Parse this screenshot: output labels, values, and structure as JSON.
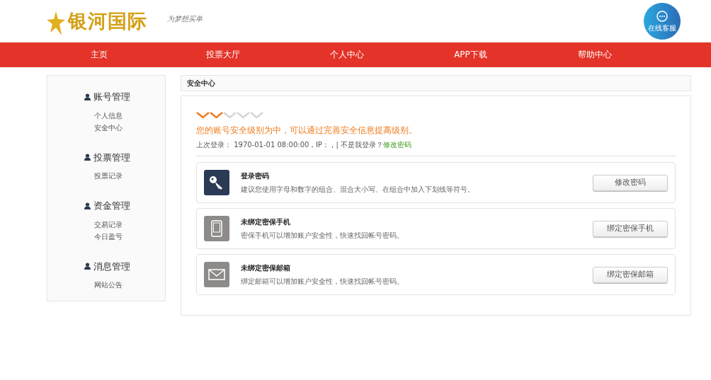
{
  "header": {
    "logo_text": "银河国际",
    "tagline": "为梦想买单",
    "service_label": "在线客服"
  },
  "nav": [
    {
      "label": "主页"
    },
    {
      "label": "投票大厅"
    },
    {
      "label": "个人中心"
    },
    {
      "label": "APP下载"
    },
    {
      "label": "帮助中心"
    }
  ],
  "sidebar": [
    {
      "title": "账号管理",
      "items": [
        "个人信息",
        "安全中心"
      ]
    },
    {
      "title": "投票管理",
      "items": [
        "投票记录"
      ]
    },
    {
      "title": "资金管理",
      "items": [
        "交易记录",
        "今日盈亏"
      ]
    },
    {
      "title": "消息管理",
      "items": [
        "网站公告"
      ]
    }
  ],
  "panel": {
    "title": "安全中心",
    "security": {
      "level": 0.4,
      "message": "您的账号安全级别为中，可以通过完善安全信息提高级别。",
      "last_login": "上次登录： 1970-01-01 08:00:00 , IP： ,  | 不是我登录？",
      "change_link": "修改密码"
    },
    "items": [
      {
        "kind": "key",
        "title": "登录密码",
        "desc": "建议您使用字母和数字的组合、混合大小写、在组合中加入下划线等符号。",
        "button": "修改密码"
      },
      {
        "kind": "phone",
        "title": "未绑定密保手机",
        "desc": "密保手机可以增加账户安全性，快速找回帐号密码。",
        "button": "绑定密保手机"
      },
      {
        "kind": "mail",
        "title": "未绑定密保邮箱",
        "desc": "绑定邮箱可以增加账户安全性，快速找回帐号密码。",
        "button": "绑定密保邮箱"
      }
    ]
  }
}
